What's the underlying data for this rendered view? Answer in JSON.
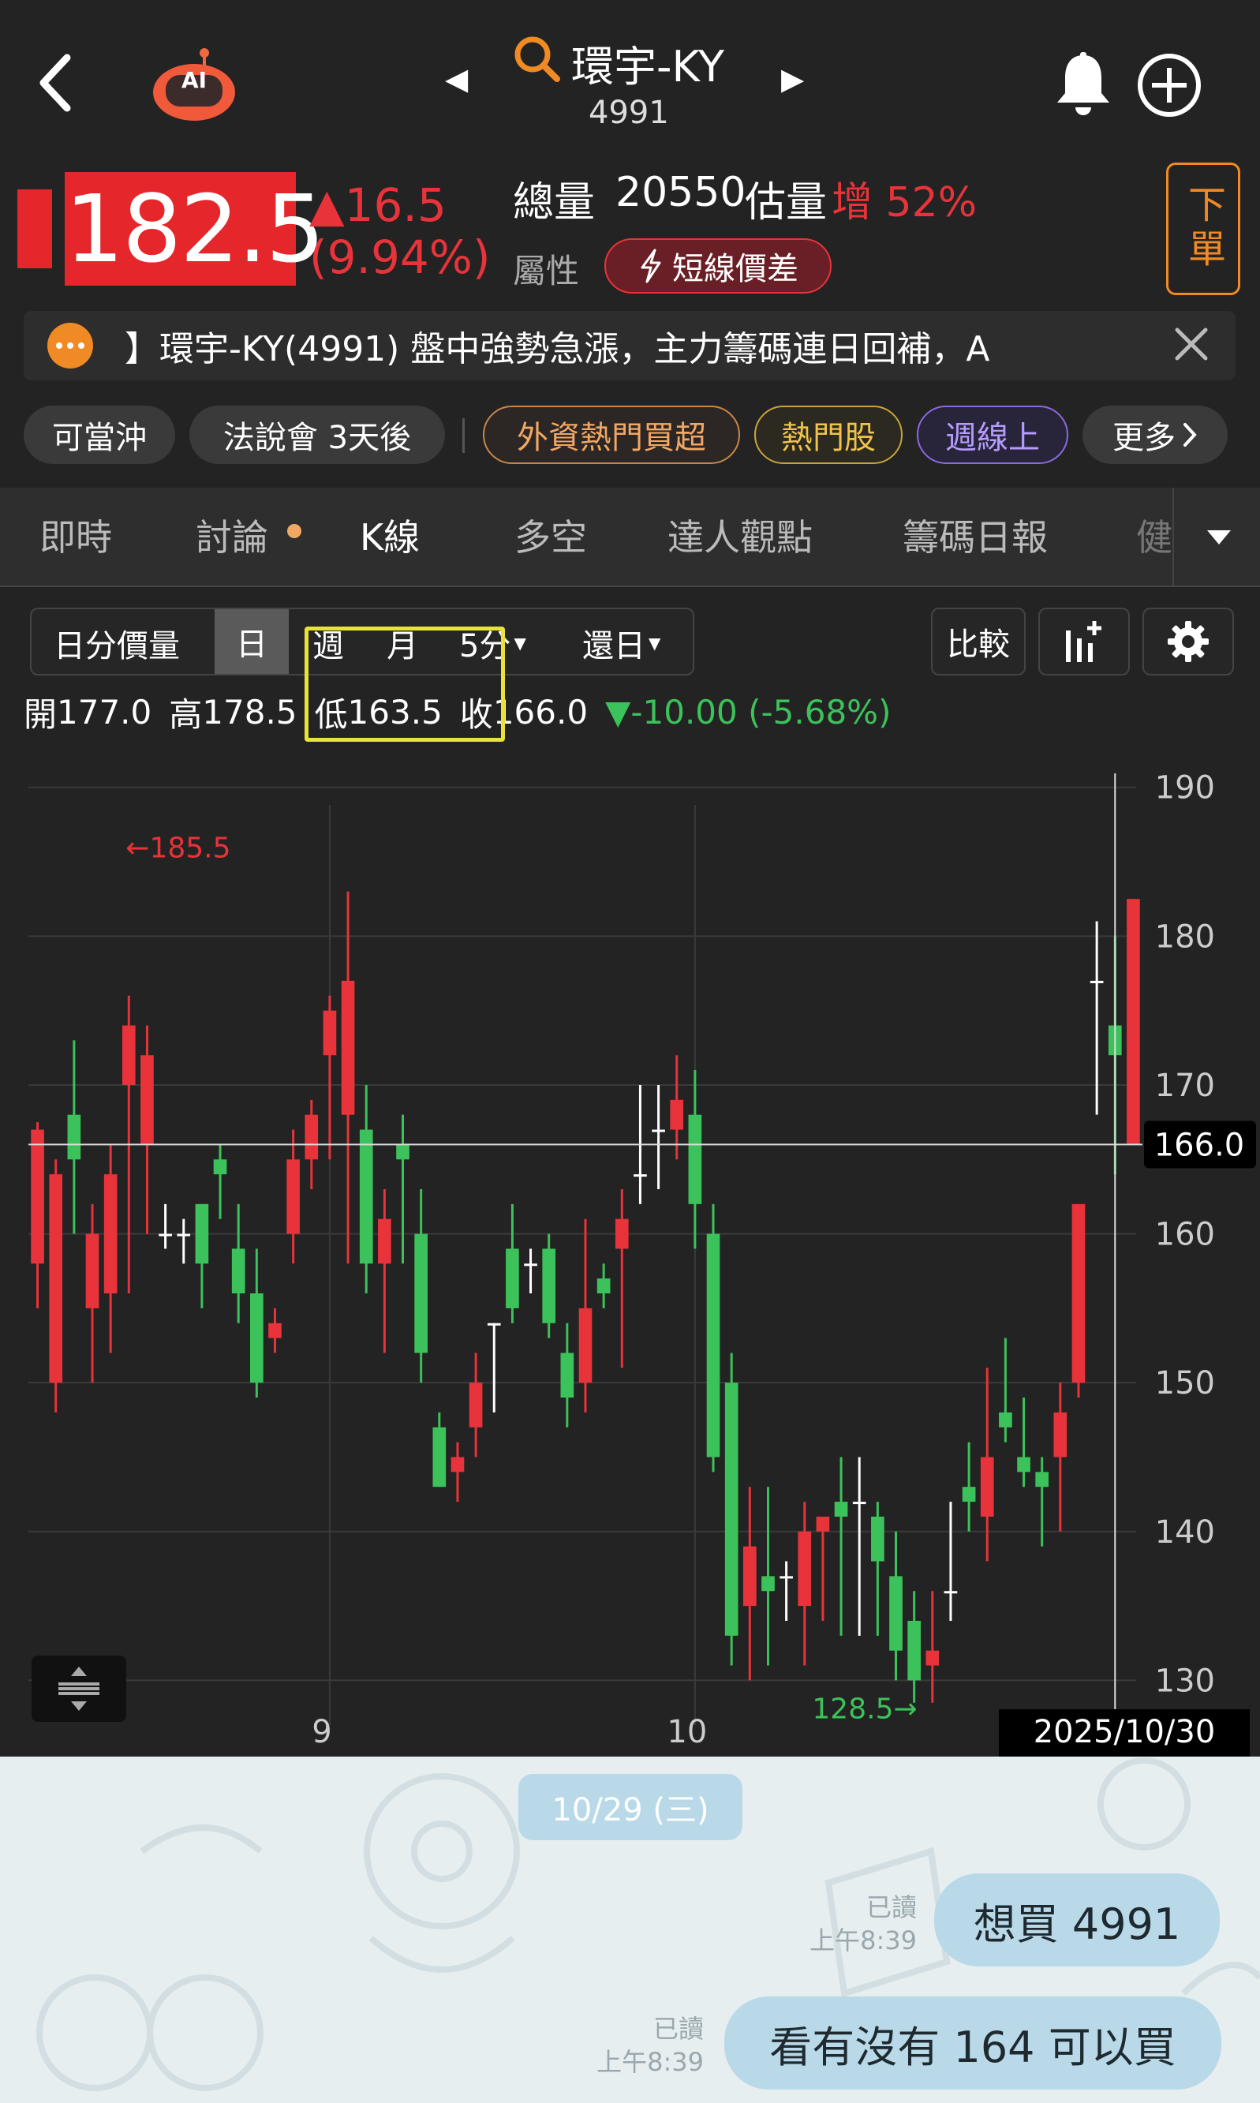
{
  "header": {
    "back_icon": "chevron-left-icon",
    "ai_label": "AI",
    "title": "環宇-KY",
    "code": "4991",
    "prev_arrow": "◀",
    "next_arrow": "▶"
  },
  "quote": {
    "price": "182.5",
    "change": "▲16.5",
    "change_pct": "(9.94%)",
    "total_label": "總量",
    "total_value": "20550",
    "est_label": "估量",
    "est_change": "增 52%",
    "attr_label": "屬性",
    "attr_badge": "短線價差",
    "order_button": "下單"
  },
  "news": {
    "text": "】環宇-KY(4991) 盤中強勢急漲，主力籌碼連日回補，A"
  },
  "tags": [
    "可當沖",
    "法說會 3天後",
    "外資熱門買超",
    "熱門股",
    "週線上",
    "更多"
  ],
  "tabs": [
    "即時",
    "討論",
    "K線",
    "多空",
    "達人觀點",
    "籌碼日報",
    "健"
  ],
  "chart_controls": {
    "volume": "日分價量",
    "periods": [
      "日",
      "週",
      "月",
      "5分"
    ],
    "restore": "還日",
    "compare": "比較"
  },
  "ohlc": {
    "open_label": "開",
    "open": "177.0",
    "high_label": "高",
    "high": "178.5",
    "low_label": "低",
    "low": "163.5",
    "close_label": "收",
    "close": "166.0",
    "change": "▼-10.00 (-5.68%)"
  },
  "colors": {
    "up": "#e8333a",
    "down": "#3cc25a",
    "highlight": "#e8e23a",
    "accent": "#f08a24"
  },
  "chart_data": {
    "type": "candlestick",
    "ylim": [
      127,
      192
    ],
    "yticks": [
      190,
      180,
      170,
      160,
      150,
      140,
      130
    ],
    "x_labels": [
      {
        "index": 16,
        "label": "9"
      },
      {
        "index": 36,
        "label": "10"
      }
    ],
    "date_label": "2025/10/30",
    "last_close_label": "166.0",
    "max_label": "←185.5",
    "min_label": "128.5→",
    "candles": [
      [
        158,
        167,
        155,
        167.5
      ],
      [
        150,
        164,
        148,
        165
      ],
      [
        168,
        165,
        160,
        173
      ],
      [
        155,
        160,
        150,
        162
      ],
      [
        156,
        164,
        152,
        166
      ],
      [
        170,
        174,
        156,
        176
      ],
      [
        166,
        172,
        160,
        174
      ],
      [
        160,
        160,
        159,
        162
      ],
      [
        160,
        160,
        158,
        161
      ],
      [
        162,
        158,
        155,
        162
      ],
      [
        165,
        164,
        161,
        166
      ],
      [
        159,
        156,
        154,
        162
      ],
      [
        156,
        150,
        149,
        159
      ],
      [
        153,
        154,
        152,
        155
      ],
      [
        160,
        165,
        158,
        167
      ],
      [
        165,
        168,
        163,
        169
      ],
      [
        172,
        175,
        165,
        176
      ],
      [
        168,
        177,
        158,
        183
      ],
      [
        167,
        158,
        156,
        170
      ],
      [
        158,
        161,
        152,
        163
      ],
      [
        166,
        165,
        158,
        168
      ],
      [
        160,
        152,
        150,
        163
      ],
      [
        147,
        143,
        143,
        148
      ],
      [
        144,
        145,
        142,
        146
      ],
      [
        147,
        150,
        145,
        152
      ],
      [
        154,
        154,
        148,
        154
      ],
      [
        159,
        155,
        154,
        162
      ],
      [
        158,
        158,
        156,
        159
      ],
      [
        159,
        154,
        153,
        160
      ],
      [
        152,
        149,
        147,
        154
      ],
      [
        150,
        155,
        148,
        161
      ],
      [
        157,
        156,
        155,
        158
      ],
      [
        159,
        161,
        151,
        163
      ],
      [
        164,
        164,
        162,
        170
      ],
      [
        167,
        167,
        163,
        170
      ],
      [
        167,
        169,
        165,
        172
      ],
      [
        168,
        162,
        159,
        171
      ],
      [
        160,
        145,
        144,
        162
      ],
      [
        150,
        133,
        131,
        152
      ],
      [
        135,
        139,
        130,
        143
      ],
      [
        137,
        136,
        131,
        143
      ],
      [
        137,
        137,
        134,
        138
      ],
      [
        135,
        140,
        131,
        142
      ],
      [
        140,
        141,
        134,
        141
      ],
      [
        142,
        141,
        133,
        145
      ],
      [
        142,
        142,
        133,
        145
      ],
      [
        141,
        138,
        133,
        142
      ],
      [
        137,
        132,
        130,
        140
      ],
      [
        134,
        130,
        128.5,
        136
      ],
      [
        131,
        132,
        128.5,
        136
      ],
      [
        136,
        136,
        134,
        142
      ],
      [
        143,
        142,
        140,
        146
      ],
      [
        141,
        145,
        138,
        151
      ],
      [
        148,
        147,
        146,
        153
      ],
      [
        145,
        144,
        143,
        149
      ],
      [
        144,
        143,
        139,
        145
      ],
      [
        145,
        148,
        140,
        150
      ],
      [
        150,
        162,
        149,
        162
      ],
      [
        177,
        177,
        168,
        181
      ],
      [
        174,
        172,
        164,
        180
      ],
      [
        166,
        182.5,
        166,
        182.5
      ]
    ]
  },
  "chat": {
    "date_chip": "10/29 (三)",
    "messages": [
      {
        "status": "已讀",
        "time": "上午8:39",
        "text": "想買 4991"
      },
      {
        "status": "已讀",
        "time": "上午8:39",
        "text": "看有沒有 164 可以買"
      }
    ]
  }
}
